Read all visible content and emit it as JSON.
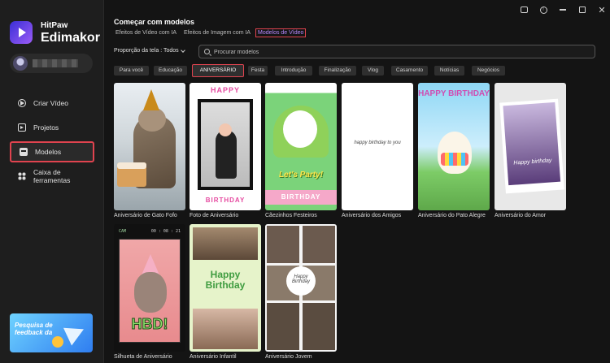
{
  "brand": {
    "top": "HitPaw",
    "name": "Edimakor"
  },
  "sidebar": {
    "items": [
      {
        "label": "Criar Vídeo",
        "icon": "video-play-icon"
      },
      {
        "label": "Projetos",
        "icon": "projects-icon"
      },
      {
        "label": "Modelos",
        "icon": "templates-icon"
      },
      {
        "label": "Caixa de ferramentas",
        "icon": "toolbox-icon"
      }
    ],
    "feedback": "Pesquisa de feedback da"
  },
  "header": {
    "title": "Começar com modelos",
    "tabs": [
      {
        "label": "Efeitos de Vídeo com IA"
      },
      {
        "label": "Efeitos de Imagem com IA"
      },
      {
        "label": "Modelos de Vídeo"
      }
    ]
  },
  "filters": {
    "aspect_label": "Proporção da tela : Todos",
    "search_placeholder": "Procurar modelos",
    "chips": [
      "Para você",
      "Educação",
      "ANIVERSÁRIO",
      "Festa",
      "Introdução",
      "Finalização",
      "Vlog",
      "Casamento",
      "Notícias",
      "Negócios"
    ],
    "active_chip": "ANIVERSÁRIO"
  },
  "templates": [
    {
      "name": "Aniversário de Gato Fofo"
    },
    {
      "name": "Foto de Aniversário",
      "t1": "HAPPY",
      "t2": "BIRTHDAY"
    },
    {
      "name": "Cãezinhos Festeiros",
      "t1": "Let's Party!",
      "t2": "BIRTHDAY"
    },
    {
      "name": "Aniversário dos Amigos",
      "t1": "happy birthday to you"
    },
    {
      "name": "Aniversário do Pato Alegre",
      "t1": "HAPPY BIRTHDAY"
    },
    {
      "name": "Aniversário do Amor",
      "t1": "Happy birthday"
    },
    {
      "name": "Silhueta de Aniversário",
      "t1": "HBD!",
      "cam": "CAM",
      "time": "00 : 08 : 21"
    },
    {
      "name": "Aniversário Infantil",
      "t1": "Happy Birthday"
    },
    {
      "name": "Aniversário Jovem",
      "t1": "Happy Birthday"
    }
  ],
  "colors": {
    "accent_red": "#e0434f",
    "active_tab": "#b888ff"
  }
}
